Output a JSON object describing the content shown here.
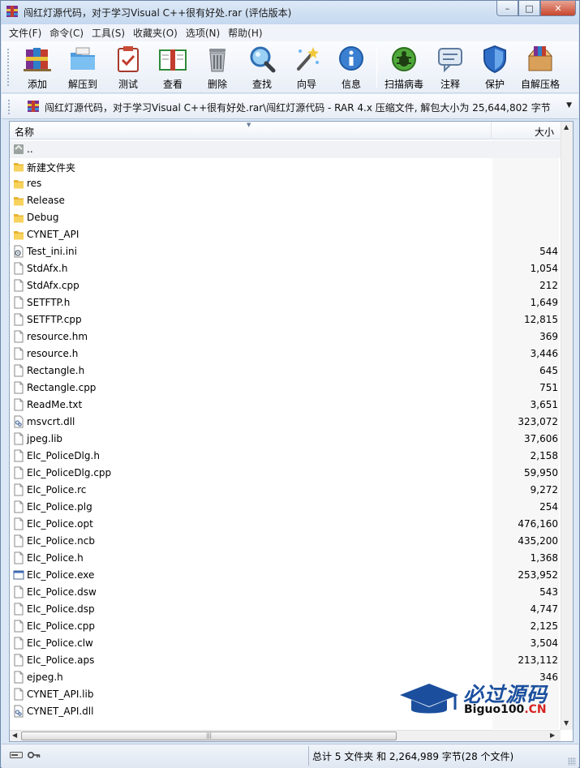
{
  "window": {
    "title": "闯红灯源代码，对于学习Visual C++很有好处.rar (评估版本)",
    "min_glyph": "–",
    "max_glyph": "□",
    "close_glyph": "✕"
  },
  "menu": [
    "文件(F)",
    "命令(C)",
    "工具(S)",
    "收藏夹(O)",
    "选项(N)",
    "帮助(H)"
  ],
  "toolbar": {
    "add": "添加",
    "extract": "解压到",
    "test": "测试",
    "view": "查看",
    "delete": "删除",
    "find": "查找",
    "wizard": "向导",
    "info": "信息",
    "virus_scan": "扫描病毒",
    "comment": "注释",
    "protect": "保护",
    "sfx": "自解压格"
  },
  "address": {
    "text": "闯红灯源代码，对于学习Visual C++很有好处.rar\\闯红灯源代码 - RAR 4.x 压缩文件, 解包大小为 25,644,802 字节"
  },
  "columns": {
    "name": "名称",
    "size": "大小"
  },
  "files": [
    {
      "name": "..",
      "size": "",
      "icon": "up-folder"
    },
    {
      "name": "新建文件夹",
      "size": "",
      "icon": "folder"
    },
    {
      "name": "res",
      "size": "",
      "icon": "folder"
    },
    {
      "name": "Release",
      "size": "",
      "icon": "folder"
    },
    {
      "name": "Debug",
      "size": "",
      "icon": "folder"
    },
    {
      "name": "CYNET_API",
      "size": "",
      "icon": "folder"
    },
    {
      "name": "Test_ini.ini",
      "size": "544",
      "icon": "settings-file"
    },
    {
      "name": "StdAfx.h",
      "size": "1,054",
      "icon": "file"
    },
    {
      "name": "StdAfx.cpp",
      "size": "212",
      "icon": "file"
    },
    {
      "name": "SETFTP.h",
      "size": "1,649",
      "icon": "file"
    },
    {
      "name": "SETFTP.cpp",
      "size": "12,815",
      "icon": "file"
    },
    {
      "name": "resource.hm",
      "size": "369",
      "icon": "file"
    },
    {
      "name": "resource.h",
      "size": "3,446",
      "icon": "file"
    },
    {
      "name": "Rectangle.h",
      "size": "645",
      "icon": "file"
    },
    {
      "name": "Rectangle.cpp",
      "size": "751",
      "icon": "file"
    },
    {
      "name": "ReadMe.txt",
      "size": "3,651",
      "icon": "file"
    },
    {
      "name": "msvcrt.dll",
      "size": "323,072",
      "icon": "dll-file"
    },
    {
      "name": "jpeg.lib",
      "size": "37,606",
      "icon": "file"
    },
    {
      "name": "Elc_PoliceDlg.h",
      "size": "2,158",
      "icon": "file"
    },
    {
      "name": "Elc_PoliceDlg.cpp",
      "size": "59,950",
      "icon": "file"
    },
    {
      "name": "Elc_Police.rc",
      "size": "9,272",
      "icon": "file"
    },
    {
      "name": "Elc_Police.plg",
      "size": "254",
      "icon": "file"
    },
    {
      "name": "Elc_Police.opt",
      "size": "476,160",
      "icon": "file"
    },
    {
      "name": "Elc_Police.ncb",
      "size": "435,200",
      "icon": "file"
    },
    {
      "name": "Elc_Police.h",
      "size": "1,368",
      "icon": "file"
    },
    {
      "name": "Elc_Police.exe",
      "size": "253,952",
      "icon": "exe-file"
    },
    {
      "name": "Elc_Police.dsw",
      "size": "543",
      "icon": "file"
    },
    {
      "name": "Elc_Police.dsp",
      "size": "4,747",
      "icon": "file"
    },
    {
      "name": "Elc_Police.cpp",
      "size": "2,125",
      "icon": "file"
    },
    {
      "name": "Elc_Police.clw",
      "size": "3,504",
      "icon": "file"
    },
    {
      "name": "Elc_Police.aps",
      "size": "213,112",
      "icon": "file"
    },
    {
      "name": "ejpeg.h",
      "size": "346",
      "icon": "file"
    },
    {
      "name": "CYNET_API.lib",
      "size": "",
      "icon": "file"
    },
    {
      "name": "CYNET_API.dll",
      "size": "",
      "icon": "dll-file"
    }
  ],
  "watermark": {
    "title": "必过源码",
    "sub_main": "Biguo100",
    "sub_suffix": ".CN"
  },
  "status": {
    "summary": "总计 5 文件夹 和 2,264,989 字节(28 个文件)"
  },
  "scrollbar": {
    "h_thumb_glyph": "|||"
  },
  "colors": {
    "title_bar": "#c4d8ef",
    "close_button": "#c8462d",
    "watermark_blue": "#1b4f9e",
    "watermark_red": "#d62420"
  }
}
